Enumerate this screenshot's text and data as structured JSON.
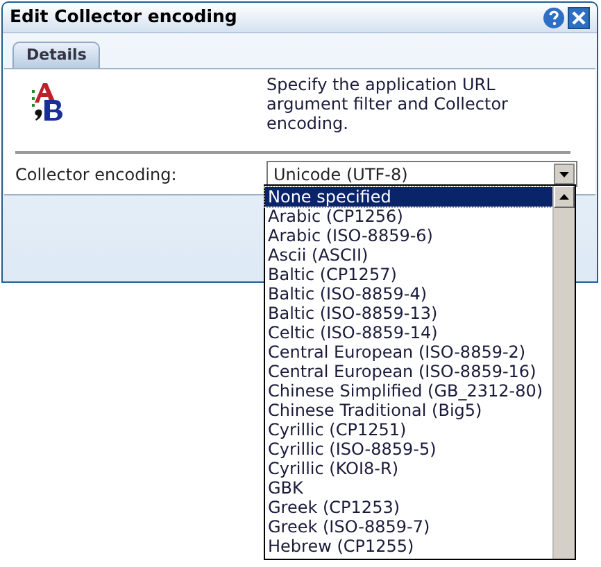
{
  "window": {
    "title": "Edit Collector encoding"
  },
  "tabs": [
    {
      "label": "Details",
      "selected": true
    }
  ],
  "description": "Specify the application URL argument filter and Collector encoding.",
  "field": {
    "label": "Collector encoding:",
    "value": "Unicode (UTF-8)",
    "expanded": true
  },
  "options": [
    {
      "label": "None specified",
      "selected": true
    },
    {
      "label": "Arabic (CP1256)",
      "selected": false
    },
    {
      "label": "Arabic (ISO-8859-6)",
      "selected": false
    },
    {
      "label": "Ascii (ASCII)",
      "selected": false
    },
    {
      "label": "Baltic (CP1257)",
      "selected": false
    },
    {
      "label": "Baltic (ISO-8859-4)",
      "selected": false
    },
    {
      "label": "Baltic (ISO-8859-13)",
      "selected": false
    },
    {
      "label": "Celtic (ISO-8859-14)",
      "selected": false
    },
    {
      "label": "Central European (ISO-8859-2)",
      "selected": false
    },
    {
      "label": "Central European (ISO-8859-16)",
      "selected": false
    },
    {
      "label": "Chinese Simplified (GB_2312-80)",
      "selected": false
    },
    {
      "label": "Chinese Traditional (Big5)",
      "selected": false
    },
    {
      "label": "Cyrillic (CP1251)",
      "selected": false
    },
    {
      "label": "Cyrillic (ISO-8859-5)",
      "selected": false
    },
    {
      "label": "Cyrillic (KOI8-R)",
      "selected": false
    },
    {
      "label": "GBK",
      "selected": false
    },
    {
      "label": "Greek (CP1253)",
      "selected": false
    },
    {
      "label": "Greek (ISO-8859-7)",
      "selected": false
    },
    {
      "label": "Hebrew (CP1255)",
      "selected": false
    }
  ]
}
